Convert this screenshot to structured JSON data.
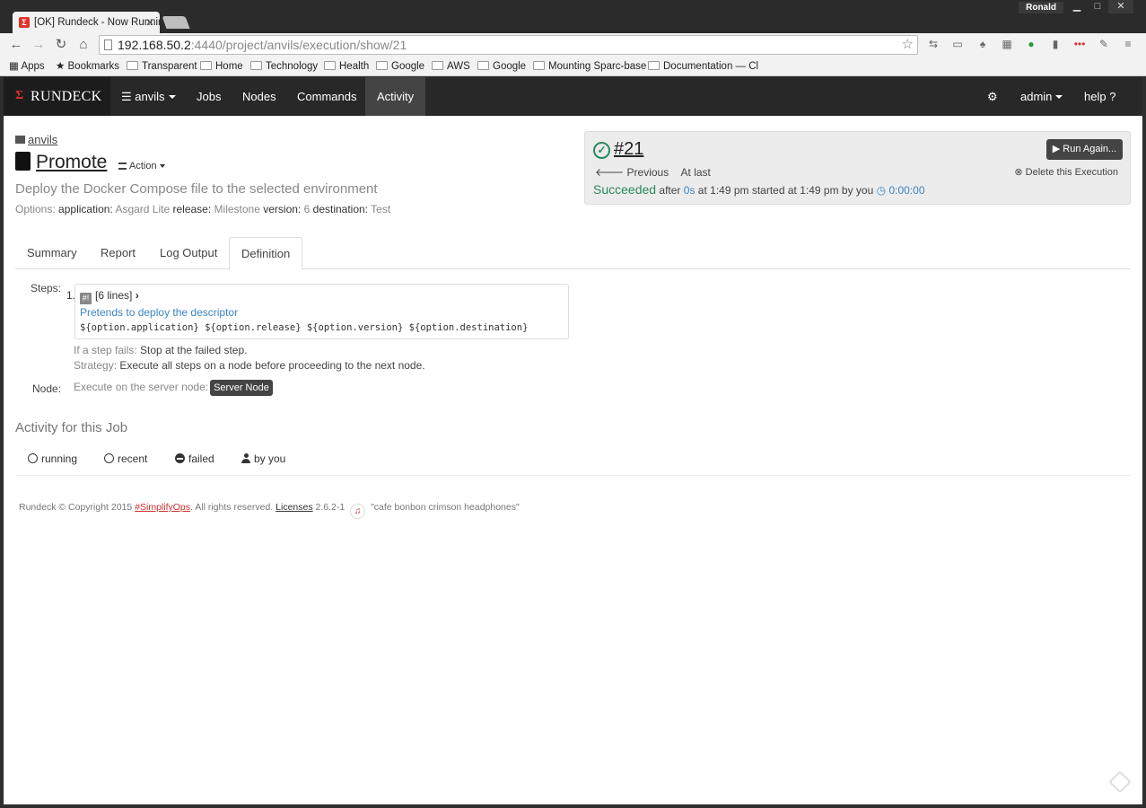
{
  "browser": {
    "os_user": "Ronald",
    "tab_title": "[OK] Rundeck - Now Running",
    "url_host": "192.168.50.2",
    "url_path": ":4440/project/anvils/execution/show/21",
    "bookmarks": [
      "Apps",
      "Bookmarks",
      "Transparent",
      "Home",
      "Technology",
      "Health",
      "Google",
      "AWS",
      "Google",
      "Mounting Sparc-base",
      "Documentation — Cl"
    ]
  },
  "navbar": {
    "brand": "RUNDECK",
    "project": "anvils",
    "items": [
      "Jobs",
      "Nodes",
      "Commands",
      "Activity"
    ],
    "user": "admin",
    "help": "help"
  },
  "job": {
    "breadcrumb": "anvils",
    "name": "Promote",
    "action": "Action",
    "description": "Deploy the Docker Compose file to the selected environment",
    "options_label": "Options:",
    "options": [
      {
        "k": "application:",
        "v": "Asgard Lite"
      },
      {
        "k": "release:",
        "v": "Milestone"
      },
      {
        "k": "version:",
        "v": "6"
      },
      {
        "k": "destination:",
        "v": "Test"
      }
    ]
  },
  "execution": {
    "number": "#21",
    "previous": "Previous",
    "at_last": "At last",
    "status": "Succeeded",
    "after": "after",
    "duration": "0s",
    "at": "at 1:49 pm",
    "started": "started",
    "started_at": "at 1:49 pm",
    "by": "by you",
    "elapsed": "0:00:00",
    "run_again": "Run Again...",
    "delete": "Delete this Execution"
  },
  "tabs": [
    "Summary",
    "Report",
    "Log Output",
    "Definition"
  ],
  "definition": {
    "steps_label": "Steps:",
    "step_number": "1.",
    "script_lines": "[6 lines]",
    "step_description": "Pretends to deploy the descriptor",
    "step_args": "${option.application} ${option.release} ${option.version} ${option.destination}",
    "if_fails_label": "If a step fails:",
    "if_fails_value": "Stop at the failed step.",
    "strategy_label": "Strategy:",
    "strategy_value": "Execute all steps on a node before proceeding to the next node.",
    "node_label": "Node:",
    "node_text": "Execute on the server node:",
    "node_badge": "Server Node"
  },
  "activity": {
    "heading": "Activity for this Job",
    "filters": [
      "running",
      "recent",
      "failed",
      "by you"
    ]
  },
  "footer": {
    "copyright": "Rundeck © Copyright 2015",
    "hashtag": "#SimplifyOps",
    "rights": ". All rights reserved.",
    "licenses": "Licenses",
    "version": "2.6.2-1",
    "codename": "\"cafe bonbon crimson headphones\""
  },
  "colors": {
    "success": "#2a8a5f",
    "link": "#3b86c4",
    "navbar": "#282828",
    "brand_red": "#e0312a"
  }
}
